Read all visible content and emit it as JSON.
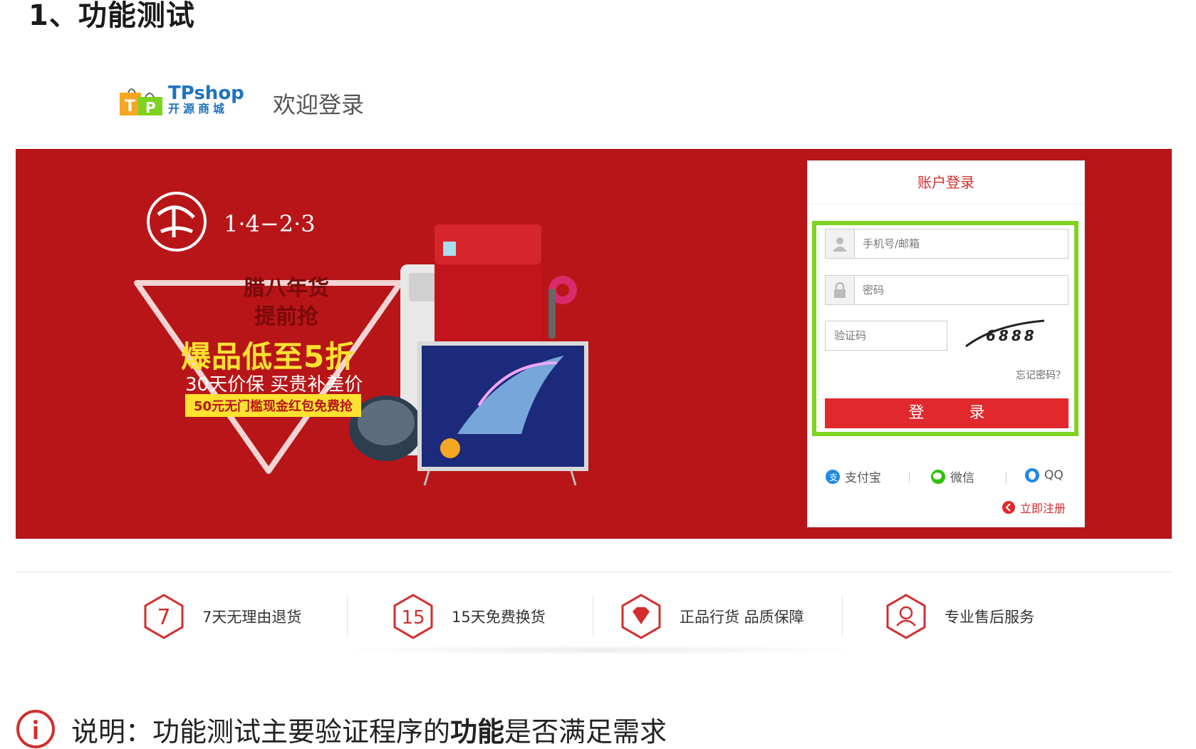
{
  "slide": {
    "heading": "1、功能测试",
    "note": {
      "prefix": "说明：功能测试主要验证程序的",
      "emphasis": "功能",
      "suffix": "是否满足需求"
    }
  },
  "header": {
    "brand_name": "TPshop",
    "brand_sub": "开源商城",
    "welcome": "欢迎登录"
  },
  "banner": {
    "date": "1·4−2·3",
    "line1": "腊八年货",
    "line2": "提前抢",
    "headline": "爆品低至5折",
    "subline": "30天价保 买贵补差价",
    "tag": "50元无门槛现金红包免费抢"
  },
  "login": {
    "title": "账户登录",
    "username_placeholder": "手机号/邮箱",
    "password_placeholder": "密码",
    "captcha_placeholder": "验证码",
    "captcha_text": "6888",
    "forgot": "忘记密码？",
    "submit": "登 录",
    "social": [
      "支付宝",
      "微信",
      "QQ"
    ],
    "register": "立即注册",
    "colors": {
      "accent": "#e1282d",
      "highlight": "#7ed321"
    }
  },
  "services": [
    {
      "badge": "7",
      "label": "7天无理由退货"
    },
    {
      "badge": "15",
      "label": "15天免费换货"
    },
    {
      "badge": "gem",
      "label": "正品行货 品质保障"
    },
    {
      "badge": "person",
      "label": "专业售后服务"
    }
  ]
}
